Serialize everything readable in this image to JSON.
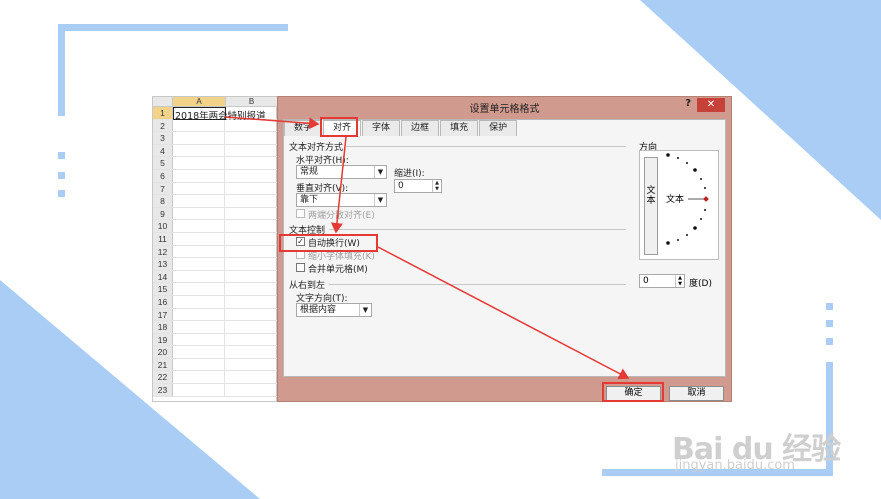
{
  "spreadsheet": {
    "columns": [
      "A",
      "B"
    ],
    "rows": [
      "1",
      "2",
      "3",
      "4",
      "5",
      "6",
      "7",
      "8",
      "9",
      "10",
      "11",
      "12",
      "13",
      "14",
      "15",
      "16",
      "17",
      "18",
      "19",
      "20",
      "21",
      "22",
      "23"
    ],
    "cell_a1": "2018年两会特别报道"
  },
  "dialog": {
    "title": "设置单元格格式",
    "help": "?",
    "close": "✕",
    "tabs": [
      "数字",
      "对齐",
      "字体",
      "边框",
      "填充",
      "保护"
    ],
    "text_alignment": {
      "section": "文本对齐方式",
      "horizontal_label": "水平对齐(H):",
      "horizontal_value": "常规",
      "indent_label": "缩进(I):",
      "indent_value": "0",
      "vertical_label": "垂直对齐(V):",
      "vertical_value": "靠下",
      "justify_distributed": "两端分散对齐(E)"
    },
    "text_control": {
      "section": "文本控制",
      "wrap_text": "自动换行(W)",
      "shrink_to_fit": "缩小字体填充(K)",
      "merge_cells": "合并单元格(M)"
    },
    "rtl": {
      "section": "从右到左",
      "direction_label": "文字方向(T):",
      "direction_value": "根据内容"
    },
    "orientation": {
      "label": "方向",
      "vertical_text": "文本",
      "text": "文本",
      "degrees_value": "0",
      "degrees_label": "度(D)"
    },
    "ok": "确定",
    "cancel": "取消"
  },
  "watermark": {
    "logo": "Bai du 经验",
    "url": "jingyan.baidu.com"
  },
  "colors": {
    "accent_blue": "#a9cdf5",
    "annotation_red": "#e53935",
    "dialog_frame": "#d09a8e"
  }
}
